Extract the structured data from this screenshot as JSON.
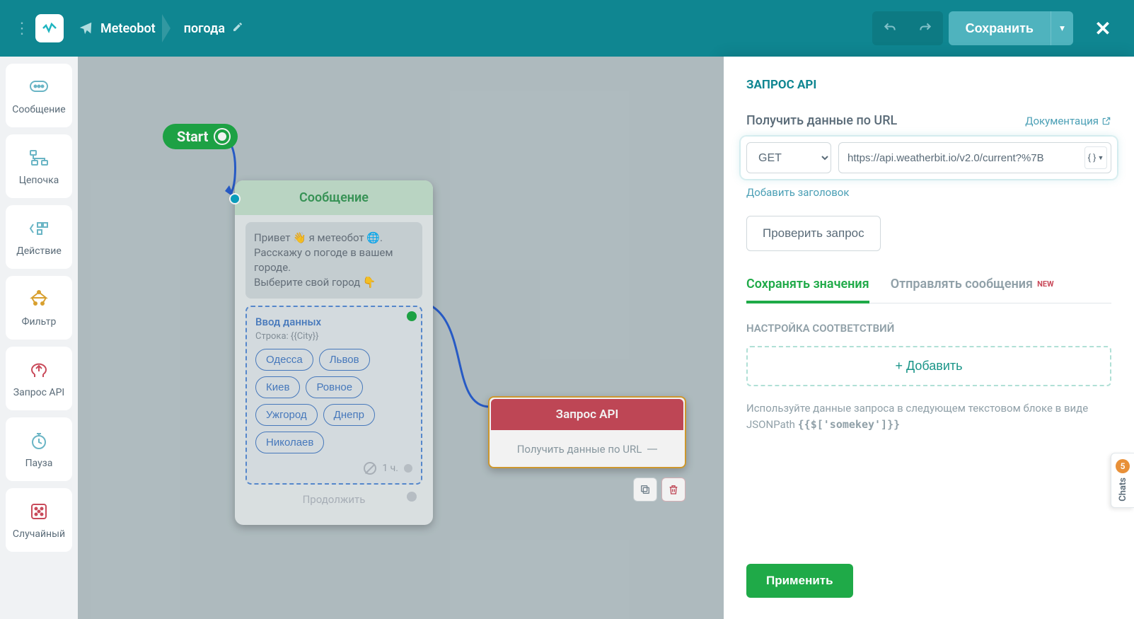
{
  "header": {
    "bot_name": "Meteobot",
    "flow_name": "погода",
    "save_label": "Сохранить"
  },
  "sidebar": {
    "items": [
      {
        "label": "Сообщение"
      },
      {
        "label": "Цепочка"
      },
      {
        "label": "Действие"
      },
      {
        "label": "Фильтр"
      },
      {
        "label": "Запрос API"
      },
      {
        "label": "Пауза"
      },
      {
        "label": "Случайный"
      }
    ]
  },
  "canvas": {
    "start_label": "Start",
    "message_node": {
      "title": "Сообщение",
      "greeting": "Привет 👋 я метеобот 🌐. Расскажу о погоде в вашем городе.\nВыберите свой город 👇",
      "input_title": "Ввод данных",
      "input_sub": "Строка: {{City}}",
      "chips": [
        "Одесса",
        "Львов",
        "Киев",
        "Ровное",
        "Ужгород",
        "Днепр",
        "Николаев"
      ],
      "timeout": "1 ч.",
      "continue": "Продолжить"
    },
    "api_node": {
      "title": "Запрос API",
      "body": "Получить данные по URL"
    }
  },
  "panel": {
    "title": "ЗАПРОС API",
    "url_label": "Получить данные по URL",
    "doc_link": "Документация",
    "method": "GET",
    "url": "https://api.weatherbit.io/v2.0/current?%7B",
    "add_header": "Добавить заголовок",
    "test_request": "Проверить запрос",
    "tabs": {
      "save": "Сохранять значения",
      "send": "Отправлять сообщения",
      "new": "NEW"
    },
    "mapping_title": "НАСТРОЙКА СООТВЕТСТВИЙ",
    "add_mapping": "+ Добавить",
    "hint_pre": "Используйте данные запроса в следующем текстовом блоке в виде JSONPath ",
    "hint_code": "{{$['somekey']}}",
    "apply": "Применить"
  },
  "chats_tab": {
    "label": "Chats",
    "count": "5"
  }
}
